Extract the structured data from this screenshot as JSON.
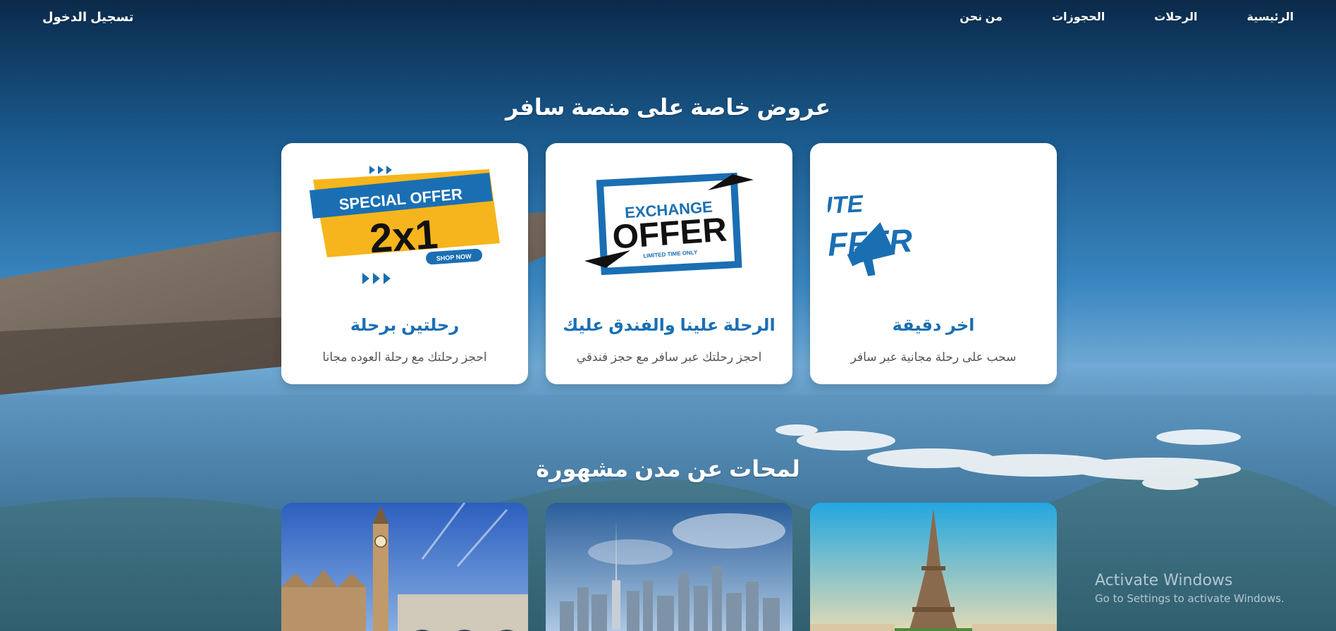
{
  "header": {
    "login_label": "تسجيل الدخول",
    "nav": [
      {
        "label": "الرئيسية"
      },
      {
        "label": "الرحلات"
      },
      {
        "label": "الحجوزات"
      },
      {
        "label": "من نحن"
      }
    ]
  },
  "offers_section": {
    "title": "عروض خاصة على منصة سافر",
    "cards": [
      {
        "title": "رحلتين برحلة",
        "description": "احجز رحلتك مع رحلة العوده مجانا",
        "image_text": [
          "SPECIAL OFFER",
          "2x1",
          "SHOP NOW"
        ]
      },
      {
        "title": "الرحلة علينا والفندق عليك",
        "description": "احجز رحلتك عبر سافر مع حجز فندقي",
        "image_text": [
          "EXCHANGE",
          "OFFER",
          "LIMITED TIME ONLY"
        ]
      },
      {
        "title": "اخر دقيقة",
        "description": "سحب على رحلة مجانية عبر سافر",
        "image_text": [
          "LAST MINUTE",
          "OFFER"
        ]
      }
    ]
  },
  "cities_section": {
    "title": "لمحات عن مدن مشهورة",
    "cities": [
      {
        "image": "london-big-ben"
      },
      {
        "image": "dubai-skyline"
      },
      {
        "image": "paris-eiffel-tower"
      }
    ]
  },
  "watermark": {
    "line1": "Activate Windows",
    "line2": "Go to Settings to activate Windows."
  },
  "colors": {
    "card_title": "#1a6fb3",
    "offer_blue": "#1a6fb3",
    "offer_yellow": "#f6b51c"
  }
}
